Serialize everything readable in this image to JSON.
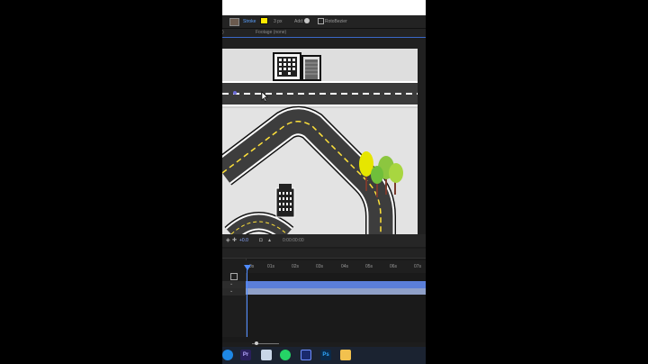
{
  "toolbar": {
    "stroke_label": "Stroke",
    "stroke_width": "3 px",
    "add_label": "Add:",
    "rotobezier_label": "RotoBezier"
  },
  "panels": {
    "left_tab": ")",
    "footage_tab": "Footage (none)"
  },
  "viewer_bar": {
    "zoom": "+0.0",
    "timecode": "0:00:00:00"
  },
  "timeline": {
    "ruler_ticks": [
      "0s",
      "01s",
      "02s",
      "03s",
      "04s",
      "05s",
      "06s",
      "07s"
    ]
  },
  "taskbar": {
    "icons": [
      "edge-icon",
      "premiere-icon",
      "file-icon",
      "whatsapp-icon",
      "media-encoder-icon",
      "photoshop-icon",
      "file-explorer-icon"
    ],
    "premiere_label": "Pr",
    "photoshop_label": "Ps"
  },
  "colors": {
    "accent": "#4f8bff",
    "stroke": "#ffea00",
    "road": "#3a3a3a",
    "canvas": "#dedede"
  }
}
